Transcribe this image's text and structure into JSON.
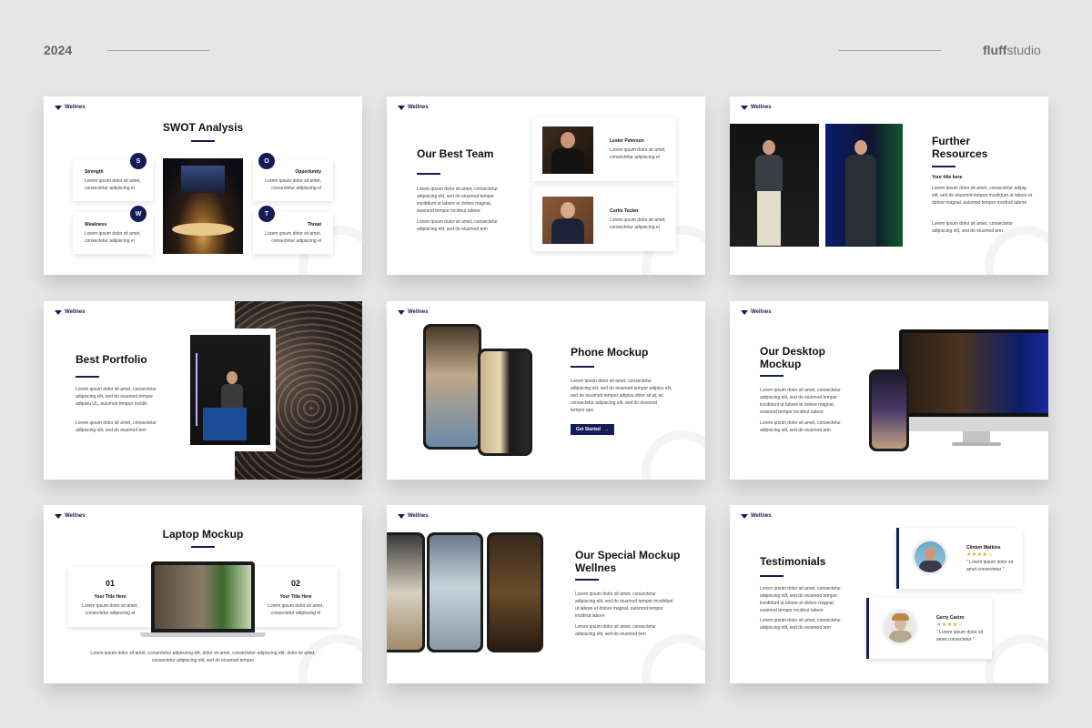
{
  "header": {
    "year": "2024",
    "brand_bold": "fluff",
    "brand_light": "studio"
  },
  "logo": "Wellnes",
  "lorem_short": "Lorem ipsum dolor sit amet, consectetur adipiscing el",
  "lorem_pair_1": "Lorem ipsum dolor sit amet,",
  "lorem_pair_2": "consectetur adipiscing el",
  "swot": {
    "title": "SWOT Analysis",
    "strength": "Strength",
    "weakness": "Weakness",
    "opportunity": "Opportunity",
    "threat": "Threat",
    "s": "S",
    "w": "W",
    "o": "O",
    "tl": "T"
  },
  "team": {
    "title": "Our Best Team",
    "para1": "Lorem ipsum dolor sit amet, consectetur adipiscing elit, sed do eiusmod tempor incididunt ut labore et dolore magnal, euismod tempor incidnut labore",
    "para2": "Lorem ipsum dolor sit amet, consectetur adipiscing elit, sed do eiusmod tem",
    "member1": "Lester Peterson",
    "member2": "Curtis Tucker"
  },
  "resources": {
    "title": "Further Resources",
    "subtitle": "Your title here",
    "para1": "Lorem ipsum dolor sit amet, consectetur adipig elit, sed do eiusmod tempor incididunt ut labore et dolore magnal, euismod tempor incidnut labore",
    "para2": "Lorem ipsum dolor sit amet, consectetur adipiscing elit, sed do eiusmod tem"
  },
  "portfolio": {
    "title": "Best Portfolio",
    "para1": "Lorem ipsum dolor sit amet, consectetur adipiscing elit, sed do eiusmod tempor adipisiu UL, euismod tempor incidin",
    "para2": "Lorem ipsum dolor sit amet, consectetur adipiscing elit, sed do eiusmod tem"
  },
  "phone": {
    "title": "Phone Mockup",
    "para1": "Lorem ipsum dolor sit amet, consectetur adipiscing elit, sed do eiusmod tempor adipisu elit, sed do eiusmod tempor adipisu dolor sit at, ac consectetur adipiscing elit, sed do eiusmod tempor aps",
    "button": "Get Started",
    "arrow": "→"
  },
  "desktop": {
    "title": "Our Desktop Mockup",
    "para1": "Lorem ipsum dolor sit amet, consectetur adipiscing elit, sed do eiusmod tempor incididunt ut labore et dolore magnal, euismod tempor incidnut labore",
    "para2": "Lorem ipsum dolor sit amet, consectetur adipiscing elit, sed do eiusmod tem"
  },
  "laptop": {
    "title": "Laptop Mockup",
    "num1": "01",
    "num2": "02",
    "card_title": "Your Title Here",
    "footer": "Lorem ipsum dolor sit amet, consectetur adipiscing elit, dolor sit amet, consectetur adipiscing elit, dolor sit amet, consectetur adipiscing elit, sed do eiusmod tempor"
  },
  "special": {
    "title": "Our Special Mockup Wellnes",
    "para1": "Lorem ipsum dolor sit amet, consectetur adipiscing elit, sed do eiusmod tempor incididunt ut labore et dolore magnal, euismod tempor incidnut labore",
    "para2": "Lorem ipsum dolor sit amet, consectetur adipiscing elit, sed do eiusmod tem"
  },
  "testimonials": {
    "title": "Testimonials",
    "para1": "Lorem ipsum dolor sit amet, consectetur adipiscing elit, sed do eiusmod tempor incididunt ut labore et dolore magnal, euismod tempor incidnut labore",
    "para2": "Lorem ipsum dolor sit amet, consectetur adipiscing elit, sed do eiusmod tem",
    "person1": "Clinton Watkins",
    "person2": "Gerry Castro",
    "stars": "★★★★☆",
    "quote": "\" Lorem ipsum dolor sit amet consectetur \""
  }
}
